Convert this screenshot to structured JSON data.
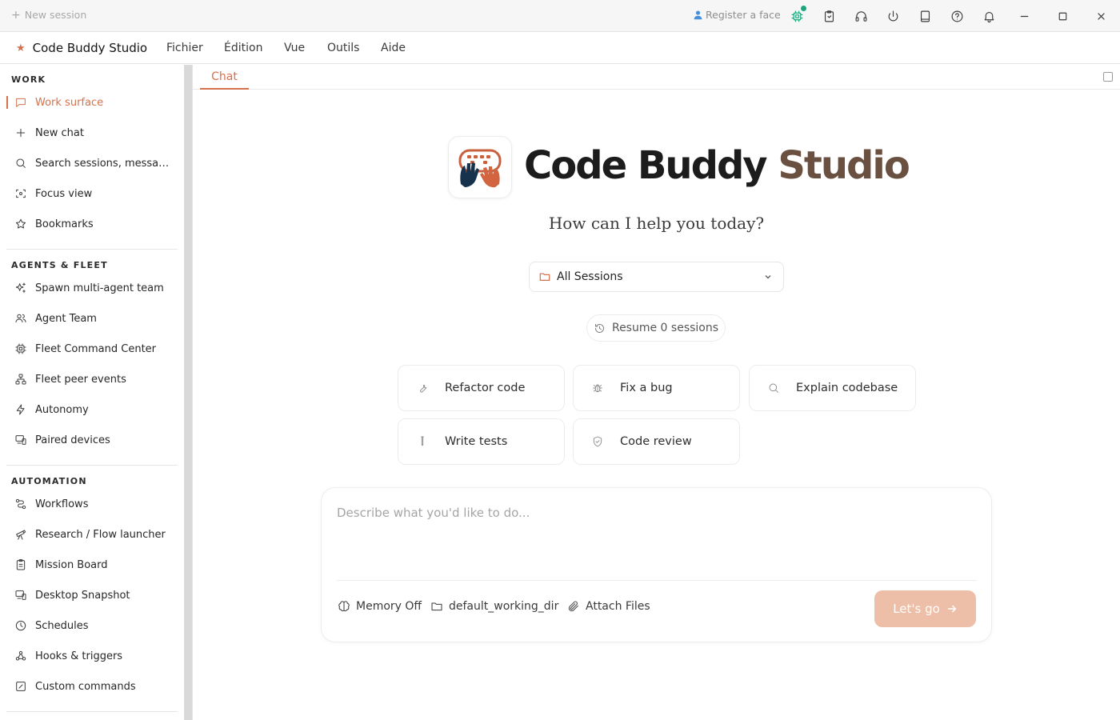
{
  "titlebar": {
    "new_session": "New session",
    "register_face": "Register a face",
    "icons": [
      "cpu-icon",
      "clipboard-icon",
      "headphones-icon",
      "power-icon",
      "tablet-icon",
      "help-icon",
      "bell-icon",
      "minimize-icon",
      "maximize-icon",
      "close-icon"
    ],
    "accent_green": "#1aa67a"
  },
  "menubar": {
    "brand": "Code Buddy Studio",
    "menus": [
      "Fichier",
      "Édition",
      "Vue",
      "Outils",
      "Aide"
    ]
  },
  "sidebar": {
    "sections": [
      {
        "title": "WORK",
        "items": [
          {
            "label": "Work surface",
            "icon": "chat-bubble-icon",
            "active": true
          },
          {
            "label": "New chat",
            "icon": "plus-icon"
          },
          {
            "label": "Search sessions, messages…",
            "icon": "search-icon"
          },
          {
            "label": "Focus view",
            "icon": "focus-icon"
          },
          {
            "label": "Bookmarks",
            "icon": "star-icon"
          }
        ]
      },
      {
        "title": "AGENTS & FLEET",
        "items": [
          {
            "label": "Spawn multi-agent team",
            "icon": "sparkles-icon"
          },
          {
            "label": "Agent Team",
            "icon": "users-icon"
          },
          {
            "label": "Fleet Command Center",
            "icon": "cpu-icon"
          },
          {
            "label": "Fleet peer events",
            "icon": "network-icon"
          },
          {
            "label": "Autonomy",
            "icon": "lightning-icon"
          },
          {
            "label": "Paired devices",
            "icon": "devices-icon"
          }
        ]
      },
      {
        "title": "AUTOMATION",
        "items": [
          {
            "label": "Workflows",
            "icon": "workflow-icon"
          },
          {
            "label": "Research / Flow launcher",
            "icon": "telescope-icon"
          },
          {
            "label": "Mission Board",
            "icon": "clipboard-list-icon"
          },
          {
            "label": "Desktop Snapshot",
            "icon": "monitor-icon"
          },
          {
            "label": "Schedules",
            "icon": "clock-icon"
          },
          {
            "label": "Hooks & triggers",
            "icon": "webhook-icon"
          },
          {
            "label": "Custom commands",
            "icon": "edit-square-icon"
          }
        ]
      }
    ],
    "accent": "#d4714d"
  },
  "main": {
    "tab": "Chat",
    "logo_title_main": "Code Buddy ",
    "logo_title_accent": "Studio",
    "help_text": "How can I help you today?",
    "session_filter": "All Sessions",
    "resume": "Resume 0 sessions",
    "quick_actions": [
      {
        "label": "Refactor code",
        "icon": "wrench-icon"
      },
      {
        "label": "Fix a bug",
        "icon": "bug-icon"
      },
      {
        "label": "Explain codebase",
        "icon": "search-icon"
      },
      {
        "label": "Write tests",
        "icon": "test-tube-icon"
      },
      {
        "label": "Code review",
        "icon": "shield-check-icon"
      }
    ],
    "composer": {
      "placeholder": "Describe what you'd like to do...",
      "memory": "Memory Off",
      "working_dir": "default_working_dir",
      "attach": "Attach Files",
      "submit": "Let's go"
    }
  }
}
